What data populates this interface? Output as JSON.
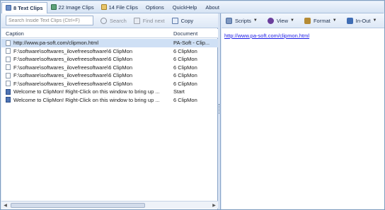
{
  "tabs": [
    {
      "label": "8 Text Clips",
      "icon": "text-clip-icon",
      "active": true
    },
    {
      "label": "22 Image Clips",
      "icon": "image-clip-icon",
      "active": false
    },
    {
      "label": "14 File Clips",
      "icon": "file-clip-icon",
      "active": false
    }
  ],
  "menu": {
    "options": "Options",
    "quickhelp": "QuickHelp",
    "about": "About"
  },
  "search": {
    "placeholder": "Search Inside Text Clips (Ctrl+F)",
    "button": "Search",
    "find_next": "Find next",
    "copy": "Copy"
  },
  "grid": {
    "headers": {
      "caption": "Caption",
      "document": "Document"
    },
    "rows": [
      {
        "caption": "http://www.pa-soft.com/clipmon.html",
        "document": "PA-Soft - Clip...",
        "selected": true
      },
      {
        "caption": "F:\\software\\softwares_ilovefreesoftware\\6 ClipMon",
        "document": "6 ClipMon"
      },
      {
        "caption": "F:\\software\\softwares_ilovefreesoftware\\6 ClipMon",
        "document": "6 ClipMon"
      },
      {
        "caption": "F:\\software\\softwares_ilovefreesoftware\\6 ClipMon",
        "document": "6 ClipMon"
      },
      {
        "caption": "F:\\software\\softwares_ilovefreesoftware\\6 ClipMon",
        "document": "6 ClipMon"
      },
      {
        "caption": "F:\\software\\softwares_ilovefreesoftware\\6 ClipMon",
        "document": "6 ClipMon"
      },
      {
        "caption": "Welcome to ClipMon! Right-Click on this window to bring up ...",
        "document": "Start"
      },
      {
        "caption": "Welcome to ClipMon! Right-Click on this window to bring up ...",
        "document": "6 ClipMon"
      }
    ]
  },
  "right_toolbar": {
    "scripts": "Scripts",
    "view": "View",
    "format": "Format",
    "inout": "In-Out"
  },
  "preview": {
    "text": "http://www.pa-soft.com/clipmon.html"
  },
  "colors": {
    "accent": "#1a1ae6",
    "selected_row": "#cfe0f5",
    "frame": "#7f9dbf"
  }
}
